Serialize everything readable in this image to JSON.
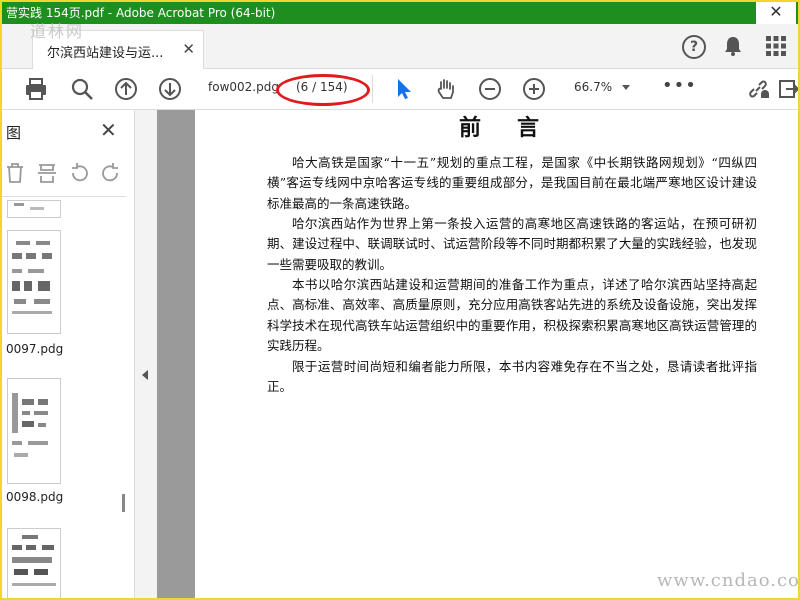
{
  "window": {
    "title": "营实践 154页.pdf - Adobe Acrobat Pro (64-bit)",
    "close_label": "✕",
    "watermark_top": "道林网",
    "watermark_bottom": "www.cndao.com"
  },
  "tabs": [
    {
      "label": "尔滨西站建设与运...",
      "close": "✕"
    }
  ],
  "toolbar": {
    "filename": "fow002.pdg",
    "page_indicator": "(6 / 154)",
    "zoom": "66.7%",
    "more": "•••"
  },
  "sidebar": {
    "title": "图",
    "close": "✕",
    "thumbnails": [
      {
        "label": "0097.pdg"
      },
      {
        "label": "0098.pdg"
      }
    ]
  },
  "document": {
    "heading": "前言",
    "paragraphs": [
      "哈大高铁是国家“十一五”规划的重点工程，是国家《中长期铁路网规划》“四纵四横”客运专线网中京哈客运专线的重要组成部分，是我国目前在最北端严寒地区设计建设标准最高的一条高速铁路。",
      "哈尔滨西站作为世界上第一条投入运营的高寒地区高速铁路的客运站，在预可研初期、建设过程中、联调联试时、试运营阶段等不同时期都积累了大量的实践经验，也发现一些需要吸取的教训。",
      "本书以哈尔滨西站建设和运营期间的准备工作为重点，详述了哈尔滨西站坚持高起点、高标准、高效率、高质量原则，充分应用高铁客站先进的系统及设备设施，突出发挥科学技术在现代高铁车站运营组织中的重要作用，积极探索积累高寒地区高铁运营管理的实践历程。",
      "限于运营时间尚短和编者能力所限，本书内容难免存在不当之处，恳请读者批评指正。"
    ]
  },
  "colors": {
    "titlebar": "#1e8e1e",
    "frame": "#f1d72a",
    "highlight_oval": "#e01b1b",
    "select_tool": "#1473e6"
  }
}
